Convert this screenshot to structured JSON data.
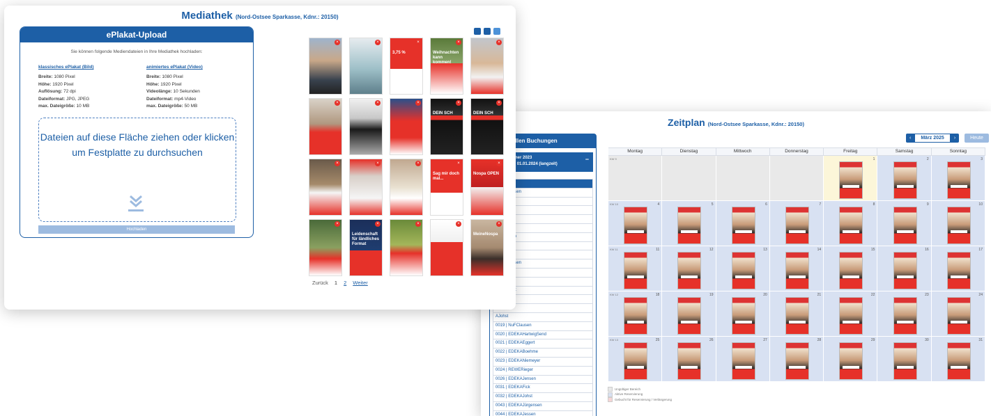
{
  "zeitplan": {
    "title": "Zeitplan",
    "title_suffix": "(Nord-Ostsee Sparkasse, Kdnr.: 20150)",
    "bookings_header": "re aktuellen Buchungen",
    "booking_sub_line1": "ndlerpartner 2023",
    "booking_sub_line2": ".01.2023 - 01.01.2024 (langzeit)",
    "booking_sub_toggle": "−",
    "booking_items": [
      "Allerger",
      "AFriedrichsen",
      "Burgdals",
      "Blasberg",
      "Hafen",
      "Ohlensen",
      "ANeumann",
      "ABoehme",
      "hordsen",
      "AFriedrichsen",
      "hordsen",
      "hordsen",
      "aulSchmidt",
      "AClausen",
      "APoch",
      "AJohst",
      "0019 | NuFClausen",
      "0020 | EDEKAHartwigSend",
      "0021 | EDEKAEggert",
      "0022 | EDEKABoehme",
      "0023 | EDEKANiemeyer",
      "0024 | REWERieger",
      "0026 | EDEKAJensen",
      "0031 | EDEKAFick",
      "0032 | EDEKAJohst",
      "0043 | EDEKAJürgensen",
      "0044 | EDEKAJessen",
      "0045 | MiMaLütteKoopmann"
    ],
    "nav_prev": "‹",
    "nav_next": "›",
    "month_label": "März 2025",
    "today_button": "Heute",
    "weekdays": [
      "Montag",
      "Dienstag",
      "Mittwoch",
      "Donnerstag",
      "Freitag",
      "Samstag",
      "Sonntag"
    ],
    "week_labels": [
      "KW 9",
      "KW 10",
      "KW 11",
      "KW 12",
      "KW 13"
    ],
    "days": [
      "",
      "",
      "",
      "",
      "1",
      "2",
      "3",
      "4",
      "5",
      "6",
      "7",
      "8",
      "9",
      "10",
      "11",
      "12",
      "13",
      "14",
      "15",
      "16",
      "17",
      "18",
      "19",
      "20",
      "21",
      "22",
      "23",
      "24",
      "25",
      "26",
      "27",
      "28",
      "29",
      "30",
      "31"
    ],
    "legend": [
      "Ungültiger Bereich",
      "Aktive Reservierung",
      "Gebucht für Reservierung / Verlängerung"
    ],
    "colors": {
      "accent": "#1d5fa6",
      "active": "#d8e1f2",
      "invalid": "#e9e9e9",
      "today": "#fcf6d9"
    }
  },
  "mediathek": {
    "title": "Mediathek",
    "title_suffix": "(Nord-Ostsee Sparkasse, Kdnr.: 20150)",
    "upload_header": "ePlakat-Upload",
    "upload_intro": "Sie können folgende Mediendateien in Ihre Mediathek hochladen:",
    "left_col_title": "klassisches ePlakat (Bild)",
    "right_col_title": "animiertes ePlakat (Video)",
    "left_specs": [
      {
        "k": "Breite:",
        "v": "1080 Pixel"
      },
      {
        "k": "Höhe:",
        "v": "1920 Pixel"
      },
      {
        "k": "Auflösung:",
        "v": "72 dpi"
      },
      {
        "k": "Dateiformat:",
        "v": "JPG, JPEG"
      },
      {
        "k": "max. Dateigröße:",
        "v": "10 MB"
      }
    ],
    "right_specs": [
      {
        "k": "Breite:",
        "v": "1080 Pixel"
      },
      {
        "k": "Höhe:",
        "v": "1920 Pixel"
      },
      {
        "k": "Videolänge:",
        "v": "10 Sekunden"
      },
      {
        "k": "Dateiformat:",
        "v": "mp4-Video"
      },
      {
        "k": "max. Dateigröße:",
        "v": "50 MB"
      }
    ],
    "drop_text": "Dateien auf diese Fläche ziehen oder klicken um Festplatte zu durchsuchen",
    "upload_button": "Hochladen",
    "thumb_delete": "×",
    "thumbnails": [
      {
        "caption": "",
        "bg": "linear-gradient(180deg,#9fb4cc 0,#c9a889 40%,#39424e 75%,#222 100%)"
      },
      {
        "caption": "",
        "bg": "linear-gradient(180deg,#e6ecef 0,#9ec0c8 55%,#5e7f8b 100%)"
      },
      {
        "caption": "3,75 %",
        "bg": "linear-gradient(180deg,#e63129 0,#e63129 55%,#ffffff 55%,#ffffff 100%)"
      },
      {
        "caption": "Weihnachten kann kommen!",
        "bg": "linear-gradient(180deg,#5a7a3a 0,#8aa56a 45%,#e63129 45%,#ffffff 100%)"
      },
      {
        "caption": "",
        "bg": "linear-gradient(180deg,#c2c6cc 0,#d8b898 45%,#f2f2f2 70%,#e63129 100%)"
      },
      {
        "caption": "",
        "bg": "linear-gradient(180deg,#d9d2c8 0,#b09880 45%,#e63129 60%,#e63129 100%)"
      },
      {
        "caption": "",
        "bg": "linear-gradient(180deg,#f0f0f0 0,#c8c8c8 35%,#1a1a1a 55%,#aaaaaa 100%)"
      },
      {
        "caption": "",
        "bg": "linear-gradient(180deg,#2b4f8a 0,#e63129 40%,#e63129 70%,#ffffff 100%)"
      },
      {
        "caption": "DEIN SCH",
        "bg": "linear-gradient(180deg,#111 0,#333 30%,#e63129 30%,#e63129 38%,#111 38%,#222 100%)"
      },
      {
        "caption": "DEIN SCH",
        "bg": "linear-gradient(180deg,#111 0,#333 30%,#e63129 30%,#e63129 38%,#111 38%,#222 100%)"
      },
      {
        "caption": "",
        "bg": "linear-gradient(180deg,#6a5a4a 0,#a58a6a 45%,#f5f5f5 60%,#e63129 100%)"
      },
      {
        "caption": "",
        "bg": "linear-gradient(180deg,#e63129 0,#d8cfc8 30%,#f5f5f5 70%,#e63129 100%)"
      },
      {
        "caption": "",
        "bg": "linear-gradient(180deg,#c0a890 0,#e8e0d0 50%,#ffffff 70%,#e63129 100%)"
      },
      {
        "caption": "Sag mir doch mal...",
        "bg": "linear-gradient(180deg,#e63129 0,#e63129 60%,#ffffff 60%,#ffffff 100%)"
      },
      {
        "caption": "Nospa OPEN",
        "bg": "linear-gradient(180deg,#e63129 0,#c02020 50%,#f2f2f2 50%,#e63129 100%)"
      },
      {
        "caption": "",
        "bg": "linear-gradient(180deg,#4a6a3a 0,#8aa060 50%,#e63129 70%,#ffffff 100%)"
      },
      {
        "caption": "Leidenschaft für ländliches Format",
        "bg": "linear-gradient(180deg,#1b2f5a 0,#1f3d70 55%,#e63129 55%,#e63129 100%)"
      },
      {
        "caption": "",
        "bg": "linear-gradient(180deg,#6a8a3a 0,#a4b65a 45%,#e63129 60%,#ffffff 100%)"
      },
      {
        "caption": "",
        "bg": "linear-gradient(180deg,#ffffff 0,#f0f0f0 40%,#e63129 40%,#e63129 100%)"
      },
      {
        "caption": "MeineNospa",
        "bg": "linear-gradient(180deg,#c9b6a0 0,#a58a70 50%,#3a2f2a 70%,#e63129 100%)"
      }
    ],
    "pager": {
      "back": "Zurück",
      "page1": "1",
      "page2": "2",
      "next": "Weiter"
    },
    "view_button_colors": [
      "#1d5fa6",
      "#1d5fa6",
      "#4d92d8"
    ]
  }
}
